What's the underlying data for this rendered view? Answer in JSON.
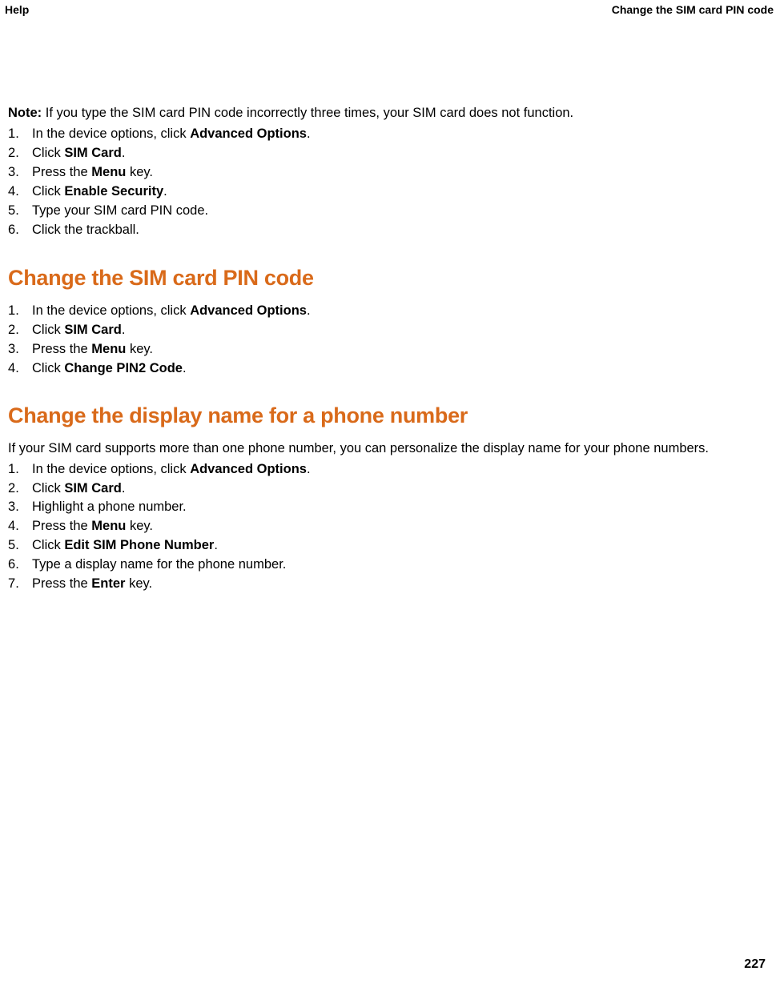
{
  "header": {
    "left": "Help",
    "right": "Change the SIM card PIN code"
  },
  "note": {
    "label": "Note:",
    "text": "  If you type the SIM card PIN code incorrectly three times, your SIM card does not function."
  },
  "section1": {
    "steps": [
      {
        "pre": "In the device options, click ",
        "bold": "Advanced Options",
        "post": "."
      },
      {
        "pre": "Click ",
        "bold": "SIM Card",
        "post": "."
      },
      {
        "pre": "Press the ",
        "bold": "Menu",
        "post": " key."
      },
      {
        "pre": "Click ",
        "bold": "Enable Security",
        "post": "."
      },
      {
        "pre": "Type your SIM card PIN code.",
        "bold": "",
        "post": ""
      },
      {
        "pre": "Click the trackball.",
        "bold": "",
        "post": ""
      }
    ]
  },
  "section2": {
    "heading": "Change the SIM card PIN code",
    "steps": [
      {
        "pre": "In the device options, click ",
        "bold": "Advanced Options",
        "post": "."
      },
      {
        "pre": "Click ",
        "bold": "SIM Card",
        "post": "."
      },
      {
        "pre": "Press the ",
        "bold": "Menu",
        "post": " key."
      },
      {
        "pre": "Click ",
        "bold": "Change PIN2 Code",
        "post": "."
      }
    ]
  },
  "section3": {
    "heading": "Change the display name for a phone number",
    "intro": "If your SIM card supports more than one phone number, you can personalize the display name for your phone numbers.",
    "steps": [
      {
        "pre": "In the device options, click ",
        "bold": "Advanced Options",
        "post": "."
      },
      {
        "pre": "Click ",
        "bold": "SIM Card",
        "post": "."
      },
      {
        "pre": "Highlight a phone number.",
        "bold": "",
        "post": ""
      },
      {
        "pre": "Press the ",
        "bold": "Menu",
        "post": " key."
      },
      {
        "pre": "Click ",
        "bold": "Edit SIM Phone Number",
        "post": "."
      },
      {
        "pre": "Type a display name for the phone number.",
        "bold": "",
        "post": ""
      },
      {
        "pre": "Press the ",
        "bold": "Enter",
        "post": " key."
      }
    ]
  },
  "page_number": "227"
}
